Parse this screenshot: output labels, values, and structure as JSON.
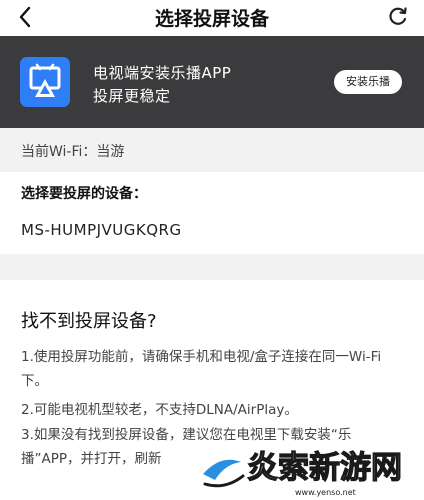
{
  "nav": {
    "title": "选择投屏设备"
  },
  "banner": {
    "line1": "电视端安装乐播APP",
    "line2": "投屏更稳定",
    "install_label": "安装乐播",
    "accent": "#2f7ef5"
  },
  "wifi": {
    "label": "当前Wi-Fi：当游"
  },
  "devices": {
    "label": "选择要投屏的设备：",
    "items": [
      "MS-HUMPJVUGKQRG"
    ]
  },
  "help": {
    "title": "找不到投屏设备?",
    "tips": [
      "1.使用投屏功能前，请确保手机和电视/盒子连接在同一Wi-Fi下。",
      "2.可能电视机型较老，不支持DLNA/AirPlay。",
      "3.如果没有找到投屏设备，建议您在电视里下载安装“乐播”APP，并打开，刷新"
    ]
  },
  "watermark": {
    "text": "炎索新游网",
    "url": "www.yenso.net"
  }
}
